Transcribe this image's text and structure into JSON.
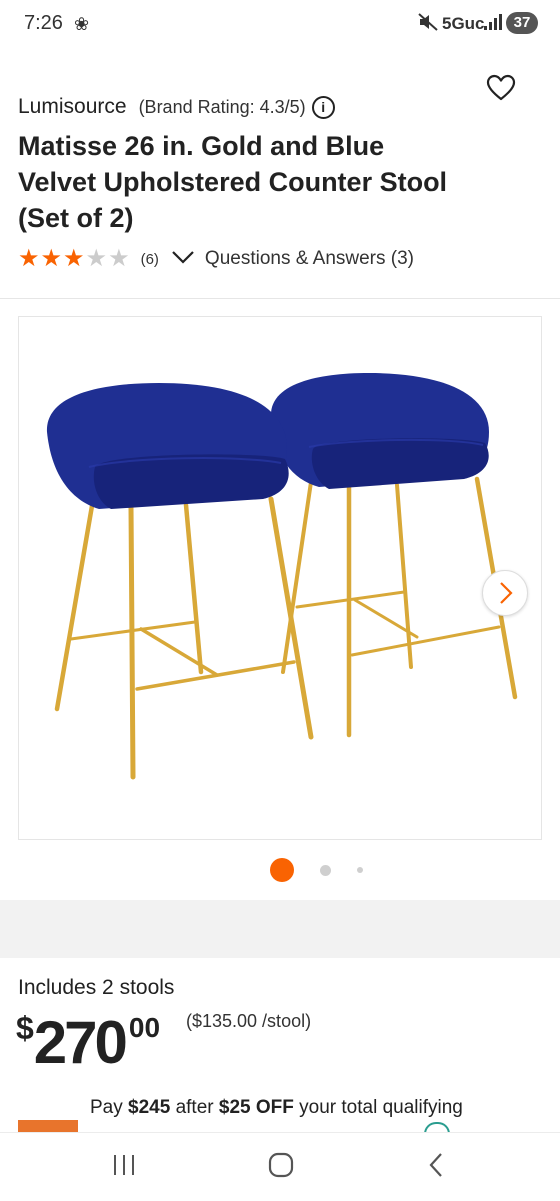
{
  "status_bar": {
    "time": "7:26",
    "network": "5Guc",
    "battery": "37"
  },
  "product": {
    "brand": "Lumisource",
    "brand_rating": "(Brand Rating: 4.3/5)",
    "title": "Matisse 26 in. Gold and Blue Velvet Upholstered Counter Stool (Set of 2)",
    "rating": 3,
    "max_rating": 5,
    "review_count": "(6)",
    "qa_label": "Questions & Answers (3)"
  },
  "gallery": {
    "image_alt": "two blue velvet counter stools with gold legs",
    "total_images": 3,
    "active_index": 0
  },
  "pricing": {
    "includes": "Includes 2 stools",
    "currency": "$",
    "dollars": "270",
    "cents": "00",
    "unit_price": "($135.00 /stool)"
  },
  "promo": {
    "pre": "Pay ",
    "amount": "$245",
    "mid": " after ",
    "discount": "$25 OFF",
    "post": " your total qualifying"
  },
  "colors": {
    "accent_orange": "#f96302",
    "star_empty": "#cccccc",
    "velvet_blue": "#1b2a8a",
    "gold": "#d8a838"
  },
  "icons": [
    "pinwheel-icon",
    "mute-icon",
    "signal-icon",
    "heart-icon",
    "info-icon",
    "star-icon",
    "chevron-down-icon",
    "chevron-right-icon",
    "recents-icon",
    "home-icon",
    "back-icon"
  ]
}
